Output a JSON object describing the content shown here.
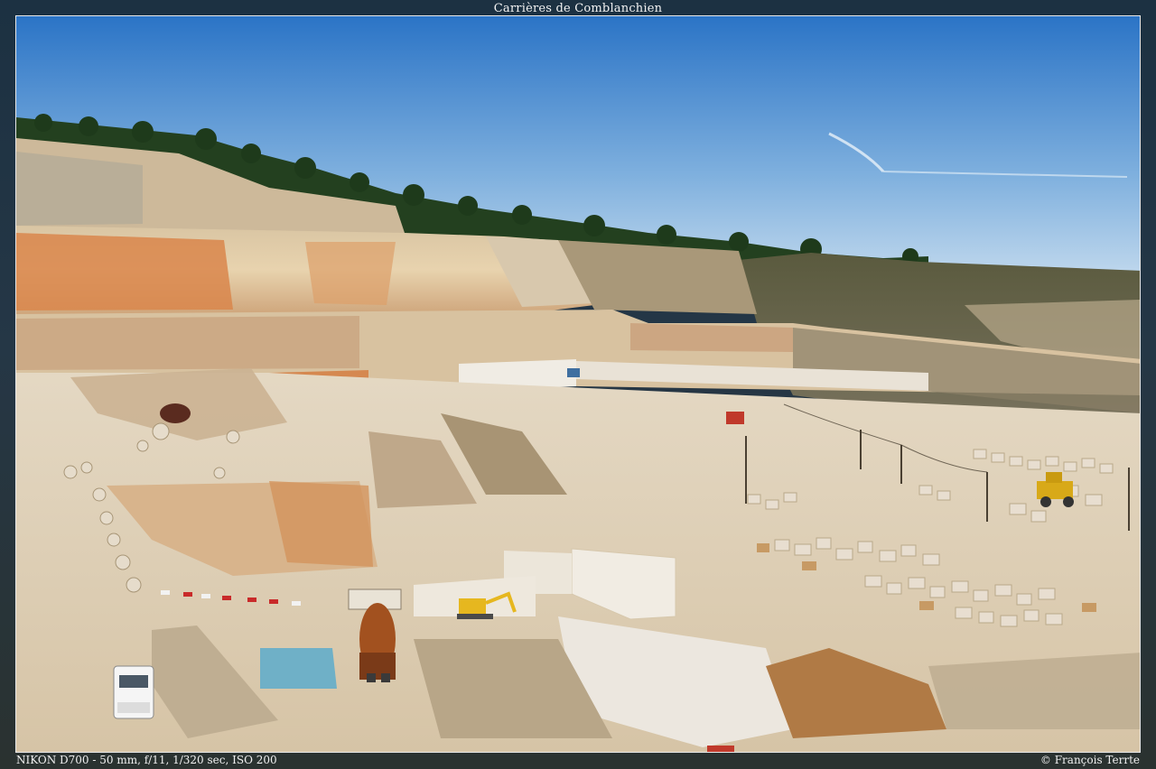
{
  "title": "Carrières de Comblanchien",
  "exif": "NIKON D700 - 50 mm, f/11, 1/320 sec, ISO 200",
  "credit": "© François Terrte",
  "colors": {
    "sky_top": "#2f78c8",
    "sky_bottom": "#cfe2f2",
    "forest": "#24401f",
    "cliff_light": "#e7cfa6",
    "cliff_orange": "#d68b4e",
    "quarry_floor": "#ddcfb6"
  }
}
